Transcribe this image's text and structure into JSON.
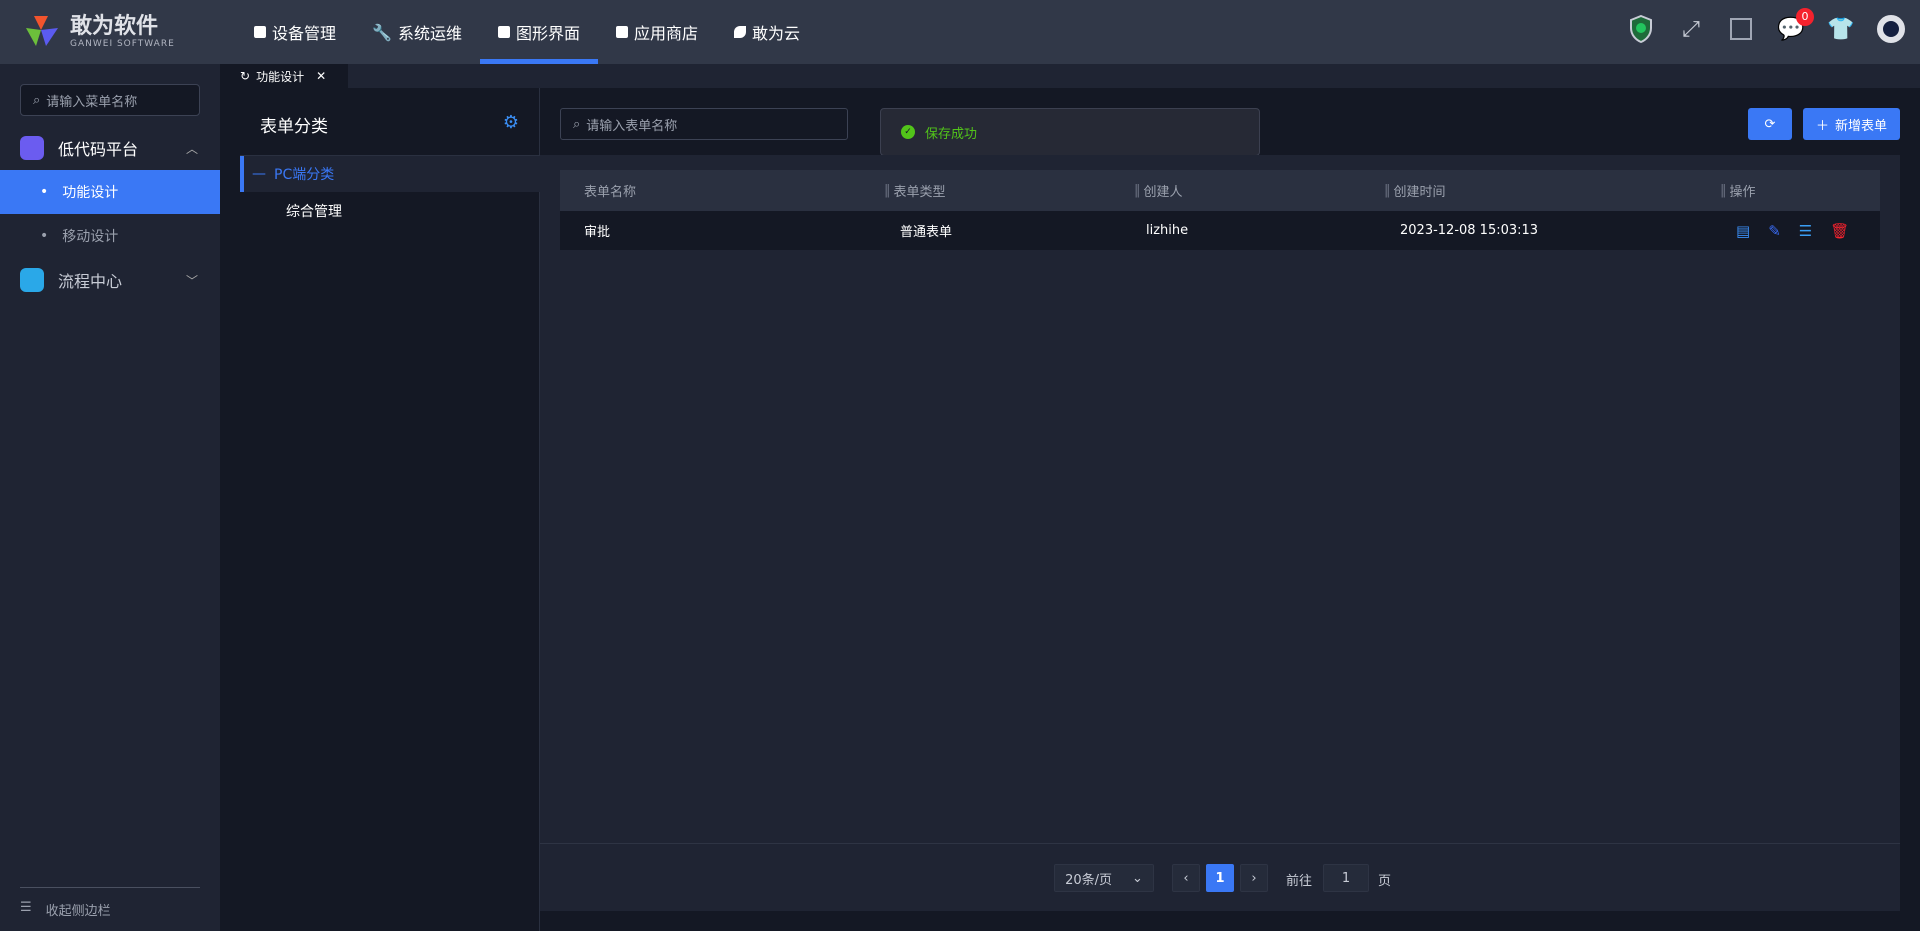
{
  "brand": {
    "name": "敢为软件",
    "sub": "GANWEI SOFTWARE"
  },
  "nav": [
    {
      "label": "设备管理"
    },
    {
      "label": "系统运维"
    },
    {
      "label": "图形界面",
      "active": true
    },
    {
      "label": "应用商店"
    },
    {
      "label": "敢为云"
    }
  ],
  "header_icons": {
    "notifications_count": "0"
  },
  "sidebar": {
    "search_placeholder": "请输入菜单名称",
    "groups": [
      {
        "label": "低代码平台",
        "items": [
          {
            "label": "功能设计",
            "active": true
          },
          {
            "label": "移动设计"
          }
        ]
      },
      {
        "label": "流程中心"
      }
    ],
    "collapse": "收起侧边栏"
  },
  "tabs": [
    {
      "label": "功能设计"
    }
  ],
  "category": {
    "title": "表单分类",
    "root": "PC端分类",
    "children": [
      "综合管理"
    ]
  },
  "main": {
    "search_placeholder": "请输入表单名称",
    "toast": "保存成功",
    "add_button": "新增表单",
    "columns": [
      "表单名称",
      "表单类型",
      "创建人",
      "创建时间",
      "操作"
    ],
    "rows": [
      {
        "name": "审批",
        "type": "普通表单",
        "creator": "lizhihe",
        "created": "2023-12-08 15:03:13"
      }
    ]
  },
  "pagination": {
    "page_size": "20条/页",
    "current": "1",
    "goto_label": "前往",
    "goto_value": "1",
    "page_suffix": "页"
  },
  "colors": {
    "accent": "#3a78f5",
    "success": "#52c41a",
    "danger": "#f5222d"
  }
}
